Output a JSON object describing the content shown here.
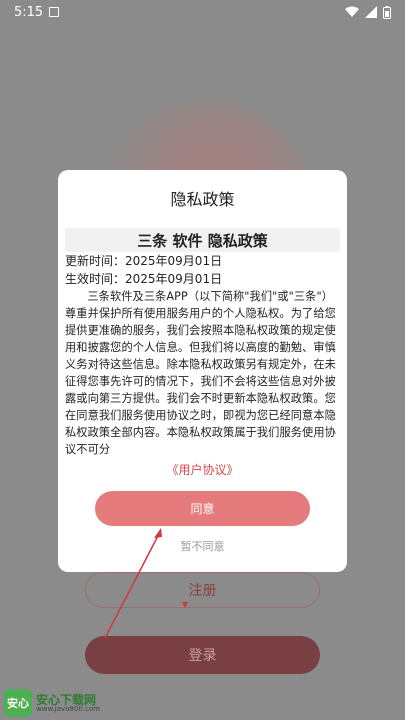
{
  "status_bar": {
    "time": "5:15"
  },
  "dialog": {
    "title": "隐私政策",
    "policy_heading": "三条 软件 隐私政策",
    "update_time": "更新时间：2025年09月01日",
    "effective_time": "生效时间：2025年09月01日",
    "body": "三条软件及三条APP（以下简称\"我们\"或\"三条\"）尊重并保护所有使用服务用户的个人隐私权。为了给您提供更准确的服务，我们会按照本隐私权政策的规定使用和披露您的个人信息。但我们将以高度的勤勉、审慎义务对待这些信息。除本隐私权政策另有规定外，在未征得您事先许可的情况下，我们不会将这些信息对外披露或向第三方提供。我们会不时更新本隐私权政策。您在同意我们服务使用协议之时，即视为您已经同意本隐私权政策全部内容。本隐私权政策属于我们服务使用协议不可分",
    "user_agreement_link": "《用户协议》",
    "agree_label": "同意",
    "disagree_label": "暂不同意"
  },
  "background": {
    "register_label": "注册",
    "login_label": "登录"
  },
  "watermark": {
    "logo_text": "安心",
    "title": "安心下载网",
    "url": "www.java800.com"
  }
}
